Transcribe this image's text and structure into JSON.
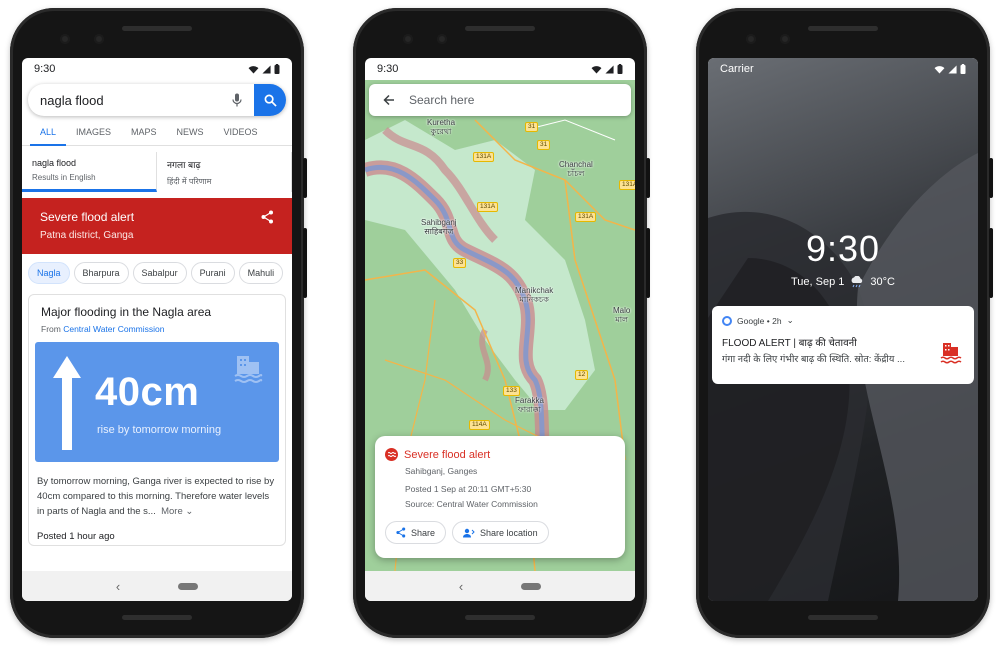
{
  "colors": {
    "accent": "#1a73e8",
    "alert_red": "#c5221f",
    "panel_blue": "#5b96ea"
  },
  "phone1": {
    "time": "9:30",
    "search_query": "nagla flood",
    "tabs": [
      "ALL",
      "IMAGES",
      "MAPS",
      "NEWS",
      "VIDEOS"
    ],
    "lang": [
      {
        "title": "nagla flood",
        "sub": "Results in English"
      },
      {
        "title": "नगला बाढ़",
        "sub": "हिंदी में परिणाम"
      }
    ],
    "alert": {
      "title": "Severe flood alert",
      "subtitle": "Patna district, Ganga"
    },
    "chips": [
      "Nagla",
      "Bharpura",
      "Sabalpur",
      "Purani",
      "Mahuli"
    ],
    "card": {
      "title": "Major flooding in the Nagla area",
      "from_prefix": "From",
      "source": "Central Water Commission",
      "big_value": "40cm",
      "big_sub": "rise by tomorrow morning",
      "body": "By tomorrow morning, Ganga river is expected to rise by 40cm compared to this morning. Therefore water levels in parts of Nagla and the s...",
      "more": "More",
      "posted": "Posted 1 hour ago"
    }
  },
  "phone2": {
    "time": "9:30",
    "search_placeholder": "Search here",
    "labels": {
      "kuretha": "Kuretha\nকুরেথা",
      "chanchal": "Chanchal\nচাঁচল",
      "sahibganj": "Sahibganj\nसाहिबगंज",
      "manikchak": "Manikchak\nমানিকচক",
      "farakka": "Farakka\nফারাক্কা",
      "malda": "Malo\nমাল"
    },
    "roads": [
      "31",
      "131A",
      "131A",
      "31",
      "131A",
      "33",
      "133",
      "114A",
      "12",
      "131A"
    ],
    "card": {
      "title": "Severe flood alert",
      "location": "Sahibganj, Ganges",
      "posted": "Posted 1 Sep at 20:11 GMT+5:30",
      "source": "Source: Central Water Commission",
      "share": "Share",
      "share_location": "Share location"
    }
  },
  "phone3": {
    "carrier": "Carrier",
    "clock": "9:30",
    "date": "Tue, Sep 1",
    "temp": "30°C",
    "notif": {
      "app": "Google • 2h",
      "title": "FLOOD ALERT | बाढ़ की चेतावनी",
      "body": "गंगा नदी के लिए गंभीर बाढ़ की स्थिति. स्रोत: केंद्रीय ..."
    }
  }
}
